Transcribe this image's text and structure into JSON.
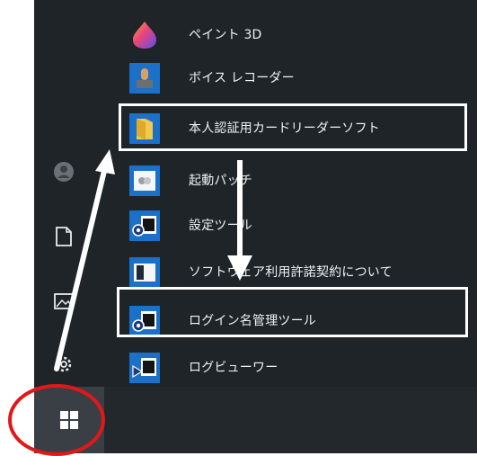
{
  "start_menu": {
    "apps": [
      {
        "label": "ペイント 3D",
        "icon": "paint-3d-icon"
      },
      {
        "label": "ボイス レコーダー",
        "icon": "voice-recorder-icon"
      },
      {
        "label": "本人認証用カードリーダーソフト",
        "icon": "folder-icon"
      },
      {
        "label": "起動パッチ",
        "icon": "launch-patch-icon"
      },
      {
        "label": "設定ツール",
        "icon": "settings-tool-icon"
      },
      {
        "label": "ソフトウェア利用許諾契約について",
        "icon": "license-icon"
      },
      {
        "label": "ログイン名管理ツール",
        "icon": "login-manager-icon"
      },
      {
        "label": "ログビューワー",
        "icon": "log-viewer-icon"
      }
    ]
  },
  "rail": {
    "items": [
      "user-avatar-icon",
      "documents-icon",
      "pictures-icon",
      "settings-gear-icon"
    ]
  },
  "taskbar": {
    "start_icon": "windows-logo-icon"
  },
  "annotations": {
    "box_color": "#ffffff",
    "circle_color": "#e01818",
    "arrow_color": "#ffffff"
  },
  "colors": {
    "menu_bg": "#1f2428",
    "tile_blue": "#1b70c8",
    "text": "#eef2f5"
  }
}
